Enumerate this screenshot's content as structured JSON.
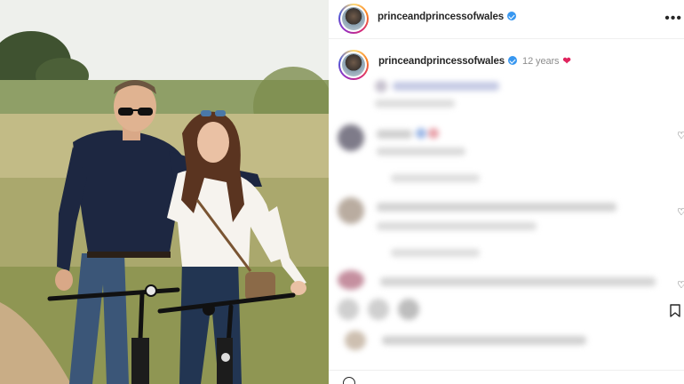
{
  "post": {
    "username": "princeandprincessofwales",
    "verified": true,
    "more_label": "•••"
  },
  "caption": {
    "username": "princeandprincessofwales",
    "time": "12 years",
    "emoji": "❤"
  },
  "icons": {
    "verified": "verified-badge-icon",
    "more": "more-options-icon",
    "like": "heart-outline-icon",
    "save": "bookmark-icon"
  },
  "colors": {
    "verified": "#3897f0",
    "heart": "#e0245e",
    "text": "#262626",
    "secondary": "#8e8e8e"
  }
}
